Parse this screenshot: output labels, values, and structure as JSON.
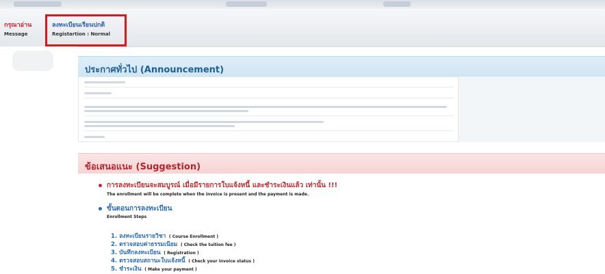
{
  "nav": {
    "message": {
      "th": "กรุณาอ่าน",
      "en": "Message"
    },
    "registration": {
      "th": "ลงทะเบียนเรียนปกติ",
      "en": "Registartion : Normal"
    }
  },
  "announcement": {
    "title": "ประกาศทั่วไป (Announcement)"
  },
  "suggestion": {
    "title": "ข้อเสนอแนะ (Suggestion)",
    "note_th": "การลงทะเบียนจะสมบูรณ์ เมื่อมีรายการใบแจ้งหนี้ และชำระเงินแล้ว เท่านั้น !!!",
    "note_en": "The enrollment will be complete when the invoice is present and the payment is made.",
    "steps_title_th": "ขั้นตอนการลงทะเบียน",
    "steps_title_en": "Enrollment Steps",
    "steps": [
      {
        "th": "1. ลงทะเบียนรายวิชา",
        "en": "( Course Enrollment )"
      },
      {
        "th": "2. ตรวจสอบค่าธรรมเนียม",
        "en": "( Check the tuition fee )"
      },
      {
        "th": "3. บันทึกลงทะเบียน",
        "en": "( Registration )"
      },
      {
        "th": "4. ตรวจสอบสถานะใบแจ้งหนี้",
        "en": "( Check your invoice status )"
      },
      {
        "th": "5. ชำระเงิน",
        "en": "( Make your payment )"
      }
    ]
  },
  "colors": {
    "highlight_box": "#e0141b",
    "announcement_accent": "#1f5f98",
    "suggestion_accent": "#b5262c",
    "link_blue": "#2a6bb5"
  }
}
